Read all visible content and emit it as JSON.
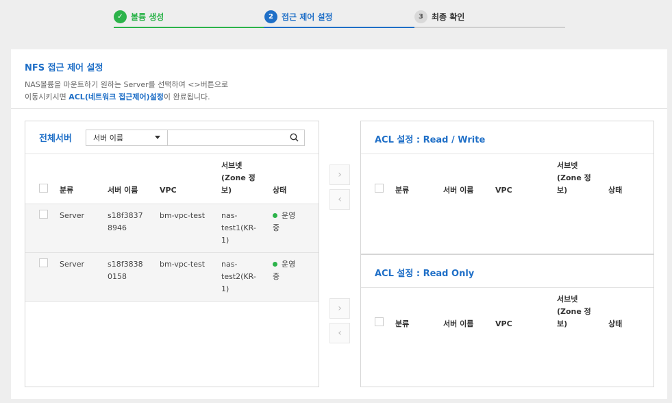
{
  "steps": [
    {
      "label": "볼륨 생성",
      "num": "✓"
    },
    {
      "label": "접근 제어 설정",
      "num": "2"
    },
    {
      "label": "최종 확인",
      "num": "3"
    }
  ],
  "panel": {
    "title": "NFS 접근 제어 설정",
    "desc_line1": "NAS볼륨을 마운트하기 원하는 Server를 선택하여 <>버튼으로",
    "desc_line2_pre": "이동시키시면 ",
    "desc_line2_hl": "ACL(네트워크 접근제어)설정",
    "desc_line2_post": "이 완료됩니다."
  },
  "left": {
    "title": "전체서버",
    "select_value": "서버 이름",
    "search_placeholder": "",
    "columns": [
      "분류",
      "서버 이름",
      "VPC",
      "서브넷\n(Zone 정\n보)",
      "상태"
    ],
    "rows": [
      {
        "type": "Server",
        "name": "s18f3837\n8946",
        "vpc": "bm-vpc-test",
        "subnet": "nas-\ntest1(KR-\n1)",
        "status": "운영\n중"
      },
      {
        "type": "Server",
        "name": "s18f3838\n0158",
        "vpc": "bm-vpc-test",
        "subnet": "nas-\ntest2(KR-\n1)",
        "status": "운영\n중"
      }
    ]
  },
  "arrows": {
    "right": "›",
    "left": "‹"
  },
  "acl_rw": {
    "title": "ACL 설정 : Read / Write",
    "columns": [
      "분류",
      "서버 이름",
      "VPC",
      "서브넷\n(Zone 정\n보)",
      "상태"
    ]
  },
  "acl_ro": {
    "title": "ACL 설정 : Read Only",
    "columns": [
      "분류",
      "서버 이름",
      "VPC",
      "서브넷\n(Zone 정\n보)",
      "상태"
    ]
  },
  "colors": {
    "accent": "#1f6fc7",
    "done": "#2cb34a",
    "status_running": "#2cb34a"
  }
}
